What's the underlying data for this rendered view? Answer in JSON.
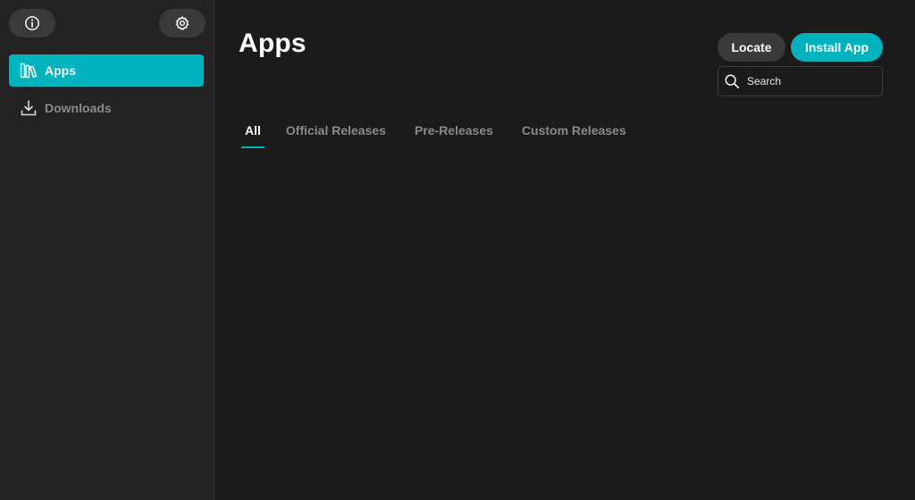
{
  "sidebar": {
    "top_buttons": [
      {
        "icon": "info-icon"
      },
      {
        "icon": "gear-icon"
      }
    ],
    "items": [
      {
        "label": "Apps",
        "icon": "library-icon",
        "active": true
      },
      {
        "label": "Downloads",
        "icon": "download-icon",
        "active": false
      }
    ]
  },
  "main": {
    "title": "Apps",
    "locate_label": "Locate",
    "install_label": "Install App",
    "search": {
      "placeholder": "Search",
      "value": ""
    },
    "tabs": [
      {
        "label": "All",
        "active": true
      },
      {
        "label": "Official Releases",
        "active": false
      },
      {
        "label": "Pre-Releases",
        "active": false
      },
      {
        "label": "Custom Releases",
        "active": false
      }
    ]
  },
  "colors": {
    "accent": "#00b3bf",
    "background": "#1b1b1b",
    "sidebar": "#232323",
    "button_secondary": "#3a3a3a",
    "inactive_text": "#8a8a8a"
  }
}
